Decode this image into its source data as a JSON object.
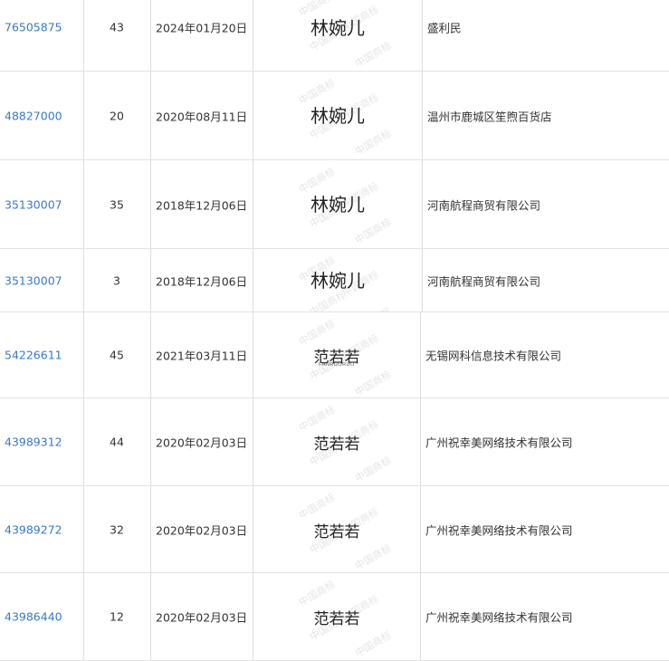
{
  "rows": [
    {
      "reg_no": "76505875",
      "cls": "43",
      "date": "2024年01月20日",
      "mark": "林婉儿",
      "mark_sub": "",
      "owner": "盛利民"
    },
    {
      "reg_no": "48827000",
      "cls": "20",
      "date": "2020年08月11日",
      "mark": "林婉儿",
      "mark_sub": "",
      "owner": "温州市鹿城区笙煦百货店"
    },
    {
      "reg_no": "35130007",
      "cls": "35",
      "date": "2018年12月06日",
      "mark": "林婉儿",
      "mark_sub": "",
      "owner": "河南航程商贸有限公司"
    },
    {
      "reg_no": "35130007",
      "cls": "3",
      "date": "2018年12月06日",
      "mark": "林婉儿",
      "mark_sub": "",
      "owner": "河南航程商贸有限公司"
    },
    {
      "reg_no": "54226611",
      "cls": "45",
      "date": "2021年03月11日",
      "mark": "范若若",
      "mark_sub": "FANRUORUO",
      "owner": "无锡网科信息技术有限公司"
    },
    {
      "reg_no": "43989312",
      "cls": "44",
      "date": "2020年02月03日",
      "mark": "范若若",
      "mark_sub": "",
      "owner": "广州祝幸美网络技术有限公司"
    },
    {
      "reg_no": "43989272",
      "cls": "32",
      "date": "2020年02月03日",
      "mark": "范若若",
      "mark_sub": "",
      "owner": "广州祝幸美网络技术有限公司"
    },
    {
      "reg_no": "43986440",
      "cls": "12",
      "date": "2020年02月03日",
      "mark": "范若若",
      "mark_sub": "",
      "owner": "广州祝幸美网络技术有限公司"
    }
  ],
  "watermark_text": "中国商标",
  "colors": {
    "link": "#3979c8",
    "border": "#e2e2e2",
    "text": "#333333"
  }
}
